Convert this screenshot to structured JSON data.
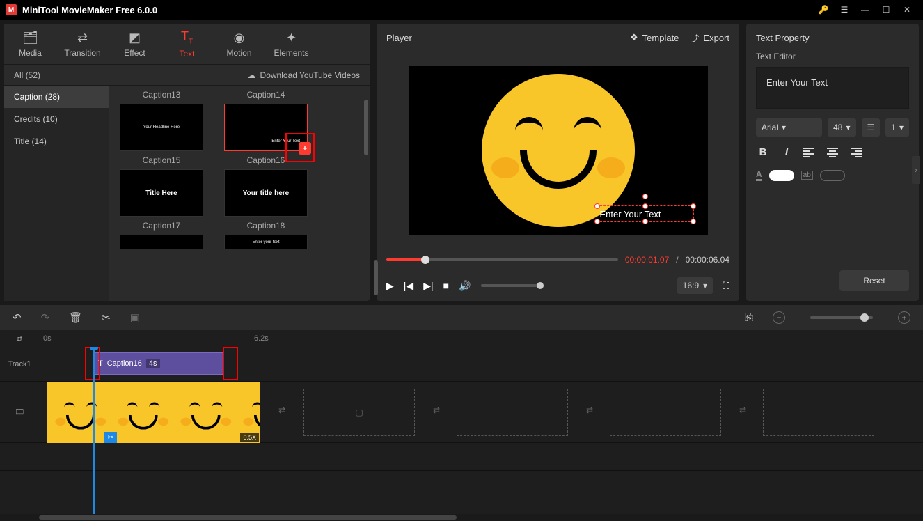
{
  "app": {
    "title": "MiniTool MovieMaker Free 6.0.0"
  },
  "tabs": {
    "media": "Media",
    "transition": "Transition",
    "effect": "Effect",
    "text": "Text",
    "motion": "Motion",
    "elements": "Elements"
  },
  "subbar": {
    "all": "All (52)",
    "download": "Download YouTube Videos"
  },
  "categories": {
    "caption": "Caption (28)",
    "credits": "Credits (10)",
    "title": "Title (14)"
  },
  "templates": {
    "r1": {
      "a": "Caption13",
      "b": "Caption14"
    },
    "r2": {
      "a": "Caption15",
      "b": "Caption16",
      "a_text": "Your Headline Here",
      "b_text": "Enter Your Text"
    },
    "r3": {
      "a": "Caption17",
      "b": "Caption18",
      "a_text": "Title Here",
      "b_text": "Your title here"
    },
    "r4": {
      "a_text": "",
      "b_text": "Enter your text"
    }
  },
  "player": {
    "label": "Player",
    "template": "Template",
    "export": "Export",
    "overlay_text": "Enter Your Text",
    "time_current": "00:00:01.07",
    "time_total": "00:00:06.04",
    "aspect": "16:9"
  },
  "textprop": {
    "title": "Text Property",
    "editor": "Text Editor",
    "placeholder": "Enter Your Text",
    "font": "Arial",
    "size": "48",
    "spacing": "1",
    "reset": "Reset"
  },
  "timeline": {
    "ruler_start": "0s",
    "ruler_mid": "6.2s",
    "track1": "Track1",
    "caption_clip": "Caption16",
    "caption_dur": "4s",
    "speed": "0.5X"
  }
}
